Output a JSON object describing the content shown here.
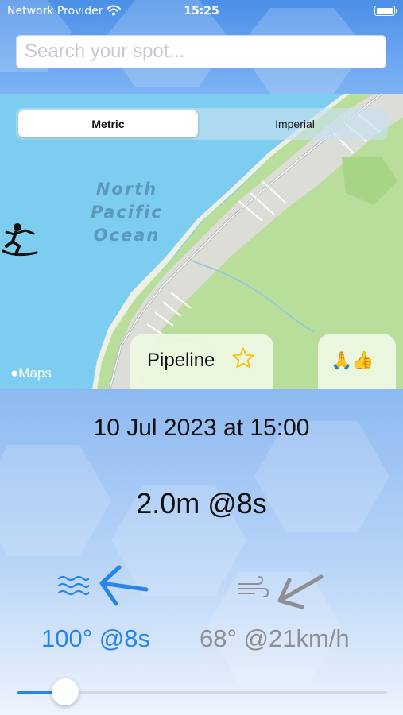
{
  "status_bar": {
    "carrier": "Network Provider",
    "time": "15:25"
  },
  "search": {
    "placeholder": "Search your spot..."
  },
  "units_control": {
    "options": [
      "Metric",
      "Imperial"
    ],
    "selected": "Metric"
  },
  "map": {
    "ocean_label": [
      "North",
      "Pacific",
      "Ocean"
    ],
    "attribution": "Maps",
    "marker_icon": "surfer-icon"
  },
  "spot_card": {
    "name": "Pipeline",
    "favorite_icon": "star-outline-icon"
  },
  "reaction_card": {
    "emojis": "🙏👍"
  },
  "forecast": {
    "datetime": "10 Jul 2023 at 15:00",
    "swell_summary": "2.0m @8s",
    "swell": {
      "icon": "waves-icon",
      "direction_text": "100° @8s",
      "color": "#2a84e8"
    },
    "wind": {
      "icon": "wind-icon",
      "direction_text": "68° @21km/h",
      "color": "#8e8e93"
    }
  },
  "time_slider": {
    "value_fraction": 0.13
  },
  "colors": {
    "accent": "#2a84e8",
    "ocean": "#7ccdf0",
    "land": "#b9dd9a"
  }
}
